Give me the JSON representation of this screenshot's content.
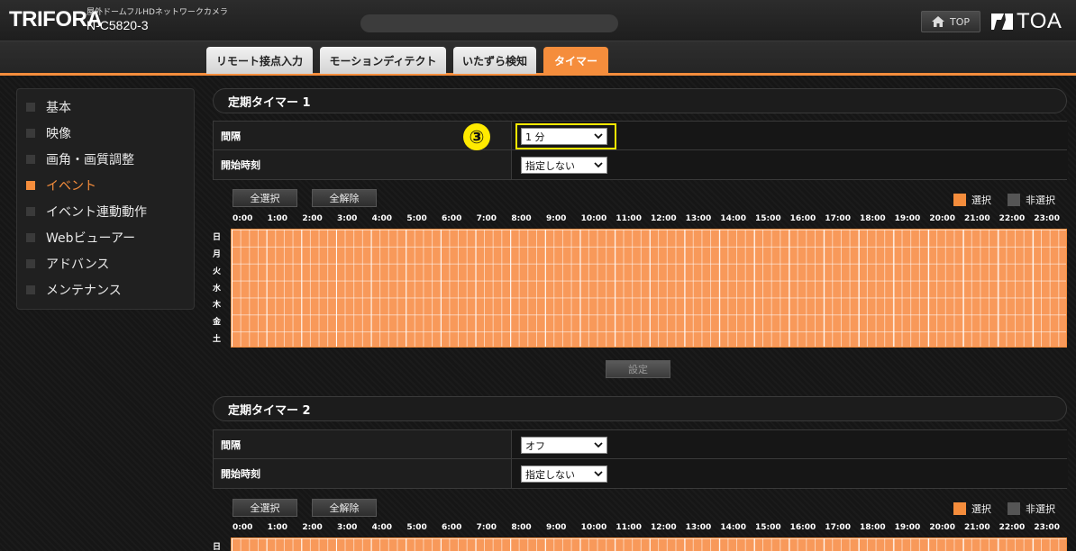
{
  "header": {
    "logo": "TRIFORA",
    "subtitle": "屋外ドームフルHDネットワークカメラ",
    "model": "N-C5820-3",
    "top_label": "TOP",
    "brand": "TOA"
  },
  "tabs": [
    {
      "label": "リモート接点入力"
    },
    {
      "label": "モーションディテクト"
    },
    {
      "label": "いたずら検知"
    },
    {
      "label": "タイマー"
    }
  ],
  "sidebar": {
    "items": [
      {
        "label": "基本"
      },
      {
        "label": "映像"
      },
      {
        "label": "画角・画質調整"
      },
      {
        "label": "イベント"
      },
      {
        "label": "イベント連動動作"
      },
      {
        "label": "Webビューアー"
      },
      {
        "label": "アドバンス"
      },
      {
        "label": "メンテナンス"
      }
    ]
  },
  "timer1": {
    "title": "定期タイマー 1",
    "interval_label": "間隔",
    "interval_value": "1 分",
    "start_label": "開始時刻",
    "start_value": "指定しない",
    "select_all": "全選択",
    "deselect_all": "全解除",
    "legend_selected": "選択",
    "legend_unselected": "非選択",
    "apply": "設定"
  },
  "timer2": {
    "title": "定期タイマー 2",
    "interval_label": "間隔",
    "interval_value": "オフ",
    "start_label": "開始時刻",
    "start_value": "指定しない",
    "select_all": "全選択",
    "deselect_all": "全解除",
    "legend_selected": "選択",
    "legend_unselected": "非選択"
  },
  "hours": [
    "0:00",
    "1:00",
    "2:00",
    "3:00",
    "4:00",
    "5:00",
    "6:00",
    "7:00",
    "8:00",
    "9:00",
    "10:00",
    "11:00",
    "12:00",
    "13:00",
    "14:00",
    "15:00",
    "16:00",
    "17:00",
    "18:00",
    "19:00",
    "20:00",
    "21:00",
    "22:00",
    "23:00"
  ],
  "days": [
    "日",
    "月",
    "火",
    "水",
    "木",
    "金",
    "土"
  ],
  "step_marker": "③",
  "colors": {
    "accent": "#f58d3c",
    "grid_selected": "#f8995a",
    "unselected": "#555555",
    "highlight": "#ffea00"
  }
}
